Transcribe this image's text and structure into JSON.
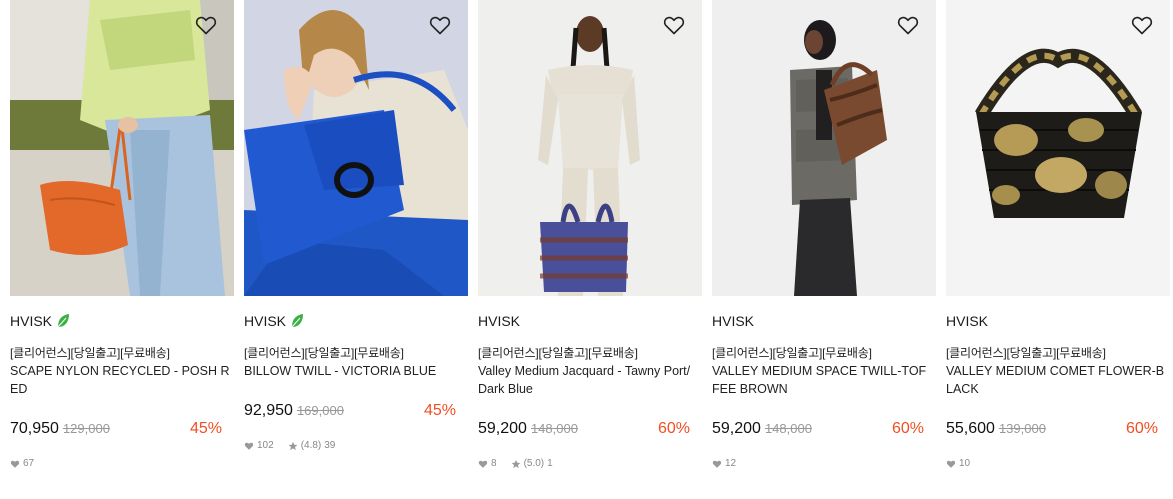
{
  "products": [
    {
      "brand": "HVISK",
      "eco": true,
      "promo": "[클리어런스][당일출고][무료배송]",
      "name": "SCAPE NYLON RECYCLED - POSH RED",
      "price": "70,950",
      "original_price": "129,000",
      "discount": "45%",
      "likes": "67",
      "rating": "",
      "reviews": ""
    },
    {
      "brand": "HVISK",
      "eco": true,
      "promo": "[클리어런스][당일출고][무료배송]",
      "name": "BILLOW TWILL - VICTORIA BLUE",
      "price": "92,950",
      "original_price": "169,000",
      "discount": "45%",
      "likes": "102",
      "rating": "(4.8)",
      "reviews": "39"
    },
    {
      "brand": "HVISK",
      "eco": false,
      "promo": "[클리어런스][당일출고][무료배송]",
      "name": "Valley Medium Jacquard - Tawny Port/Dark Blue",
      "price": "59,200",
      "original_price": "148,000",
      "discount": "60%",
      "likes": "8",
      "rating": "(5.0)",
      "reviews": "1"
    },
    {
      "brand": "HVISK",
      "eco": false,
      "promo": "[클리어런스][당일출고][무료배송]",
      "name": "VALLEY MEDIUM SPACE TWILL-TOFFEE BROWN",
      "price": "59,200",
      "original_price": "148,000",
      "discount": "60%",
      "likes": "12",
      "rating": "",
      "reviews": ""
    },
    {
      "brand": "HVISK",
      "eco": false,
      "promo": "[클리어런스][당일출고][무료배송]",
      "name": "VALLEY MEDIUM COMET FLOWER-BLACK",
      "price": "55,600",
      "original_price": "139,000",
      "discount": "60%",
      "likes": "10",
      "rating": "",
      "reviews": ""
    }
  ],
  "colors": {
    "discount": "#f04e23",
    "eco_leaf": "#3cb043",
    "muted": "#888888"
  },
  "icons": {
    "wishlist": "heart-outline-icon",
    "eco": "leaf-icon",
    "likes": "heart-filled-icon",
    "rating": "star-icon"
  }
}
